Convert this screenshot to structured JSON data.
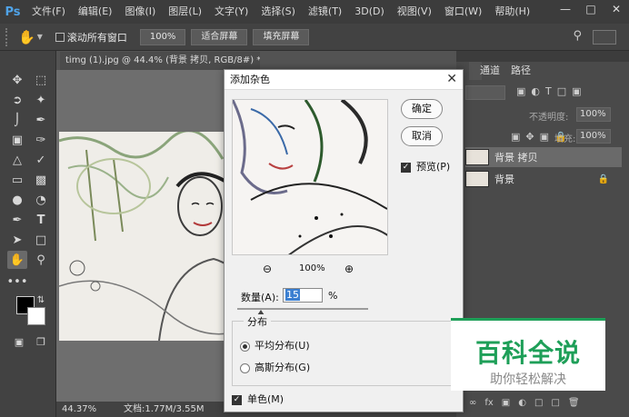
{
  "menu": {
    "logo": "Ps",
    "items": [
      "文件(F)",
      "编辑(E)",
      "图像(I)",
      "图层(L)",
      "文字(Y)",
      "选择(S)",
      "滤镜(T)",
      "3D(D)",
      "视图(V)",
      "窗口(W)",
      "帮助(H)"
    ]
  },
  "options": {
    "scroll_all": "滚动所有窗口",
    "zoom_100": "100%",
    "fit_screen": "适合屏幕",
    "fill_screen": "填充屏幕"
  },
  "document": {
    "tab_title": "timg (1).jpg @ 44.4% (背景 拷贝, RGB/8#) *",
    "zoom": "44.37%",
    "doc_size": "文档:1.77M/3.55M"
  },
  "panels": {
    "tabs": [
      "通道",
      "路径"
    ],
    "opacity_label": "不透明度:",
    "opacity_value": "100%",
    "fill_label": "填充:",
    "fill_value": "100%",
    "layers": [
      {
        "name": "背景 拷贝",
        "selected": true
      },
      {
        "name": "背景",
        "locked": true
      }
    ]
  },
  "dialog": {
    "title": "添加杂色",
    "ok": "确定",
    "cancel": "取消",
    "preview_label": "预览(P)",
    "preview_zoom": "100%",
    "amount_label": "数量(A):",
    "amount_value": "15",
    "amount_unit": "%",
    "distribution_label": "分布",
    "uniform": "平均分布(U)",
    "gaussian": "高斯分布(G)",
    "monochromatic": "单色(M)"
  },
  "watermark": {
    "line1": "百科全说",
    "line2": "助你轻松解决"
  },
  "colors": {
    "accent_blue": "#4fa3e8",
    "watermark_green": "#1e9f58"
  }
}
